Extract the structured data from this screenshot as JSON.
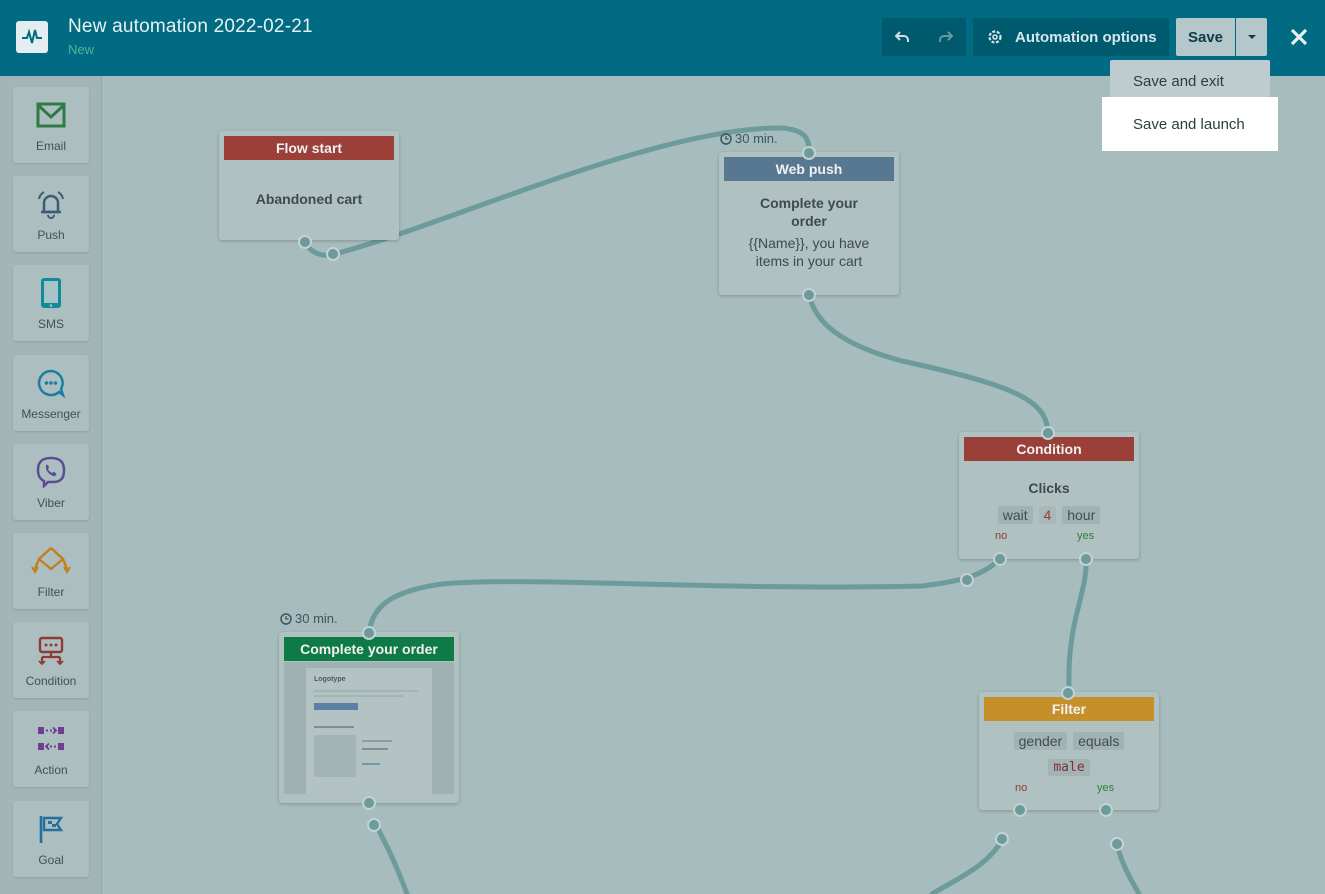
{
  "header": {
    "title": "New automation 2022-02-21",
    "status": "New",
    "automation_options_label": "Automation options",
    "save_label": "Save",
    "logo_icon": "pulse-icon",
    "colors": {
      "header_bg": "#006b82",
      "status": "#4fb39a"
    }
  },
  "dropdown": {
    "items": [
      "Save and exit",
      "Save and launch"
    ],
    "highlighted": "Save and launch"
  },
  "sidebar": {
    "items": [
      {
        "label": "Email",
        "icon": "envelope-icon"
      },
      {
        "label": "Push",
        "icon": "bell-icon"
      },
      {
        "label": "SMS",
        "icon": "phone-icon"
      },
      {
        "label": "Messenger",
        "icon": "chat-icon"
      },
      {
        "label": "Viber",
        "icon": "viber-icon"
      },
      {
        "label": "Filter",
        "icon": "filter-icon"
      },
      {
        "label": "Condition",
        "icon": "condition-icon"
      },
      {
        "label": "Action",
        "icon": "action-icon"
      },
      {
        "label": "Goal",
        "icon": "flag-icon"
      }
    ]
  },
  "nodes": {
    "flow_start": {
      "header": "Flow start",
      "body": "Abandoned cart"
    },
    "web_push": {
      "timer": "30 min.",
      "header": "Web push",
      "title": "Complete your order",
      "text": "{{Name}}, you have items in your cart"
    },
    "condition": {
      "header": "Condition",
      "title": "Clicks",
      "wait": "wait",
      "amount": "4",
      "unit": "hour",
      "no": "no",
      "yes": "yes"
    },
    "email": {
      "timer": "30 min.",
      "header": "Complete your order",
      "preview_logo": "Logotype"
    },
    "filter": {
      "header": "Filter",
      "field": "gender",
      "operator": "equals",
      "value": "male",
      "no": "no",
      "yes": "yes"
    }
  }
}
